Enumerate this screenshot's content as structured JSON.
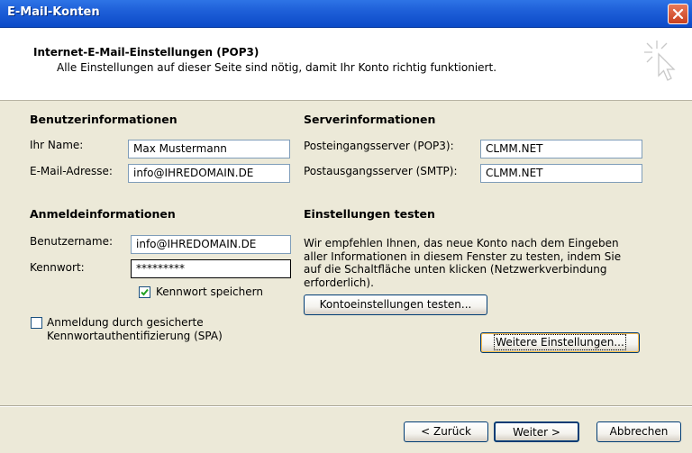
{
  "window": {
    "title": "E-Mail-Konten"
  },
  "header": {
    "title": "Internet-E-Mail-Einstellungen (POP3)",
    "subtitle": "Alle Einstellungen auf dieser Seite sind nötig, damit Ihr Konto richtig funktioniert."
  },
  "user_info": {
    "heading": "Benutzerinformationen",
    "name_label": "Ihr Name:",
    "name_value": "Max Mustermann",
    "email_label": "E-Mail-Adresse:",
    "email_value": "info@IHREDOMAIN.DE"
  },
  "server_info": {
    "heading": "Serverinformationen",
    "incoming_label": "Posteingangsserver (POP3):",
    "incoming_value": "CLMM.NET",
    "outgoing_label": "Postausgangsserver (SMTP):",
    "outgoing_value": "CLMM.NET"
  },
  "login_info": {
    "heading": "Anmeldeinformationen",
    "username_label": "Benutzername:",
    "username_value": "info@IHREDOMAIN.DE",
    "password_label": "Kennwort:",
    "password_value": "*********",
    "save_password_label": "Kennwort speichern",
    "save_password_checked": true,
    "spa_label_line1": "Anmeldung durch gesicherte",
    "spa_label_line2": "Kennwortauthentifizierung (SPA)",
    "spa_checked": false
  },
  "test_settings": {
    "heading": "Einstellungen testen",
    "description": "Wir empfehlen Ihnen, das neue Konto nach dem Eingeben aller Informationen in diesem Fenster zu testen, indem Sie auf die Schaltfläche unten klicken (Netzwerkverbindung erforderlich).",
    "test_button": "Kontoeinstellungen testen...",
    "more_settings_button": "Weitere Einstellungen..."
  },
  "footer": {
    "back_button": "< Zurück",
    "next_button": "Weiter >",
    "cancel_button": "Abbrechen"
  },
  "colors": {
    "titlebar": "#0B4AC8",
    "dialog_bg": "#ECE9D8",
    "input_border": "#7F9DB9",
    "button_border": "#003C74"
  }
}
